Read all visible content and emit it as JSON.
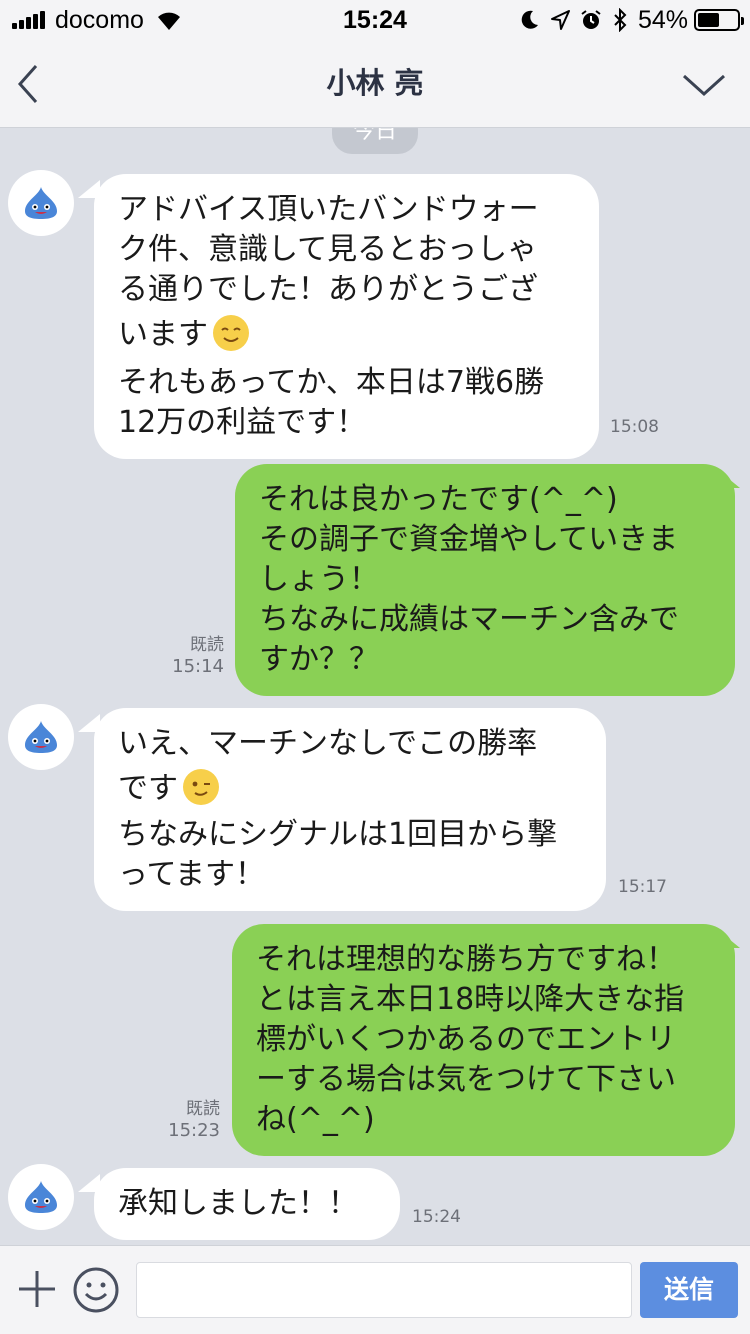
{
  "status_bar": {
    "carrier": "docomo",
    "time": "15:24",
    "battery_percent": "54%",
    "battery_level": 0.54,
    "icons": [
      "signal-icon",
      "wifi-icon",
      "moon-icon",
      "location-icon",
      "alarm-icon",
      "bluetooth-icon",
      "battery-icon"
    ]
  },
  "header": {
    "title": "小林 亮",
    "back_icon": "chevron-left-icon",
    "menu_icon": "chevron-down-icon"
  },
  "date_badge": "今日",
  "messages": [
    {
      "id": "m1",
      "direction": "in",
      "lines": [
        "アドバイス頂いたバンドウォー",
        "ク件、意識して見るとおっしゃ",
        "る通りでした！ありがとうござ",
        "います",
        "それもあってか、本日は7戦6勝",
        "12万の利益です！"
      ],
      "emoji_after_line": 3,
      "emoji": "smiling-face-emoji",
      "time": "15:08"
    },
    {
      "id": "m2",
      "direction": "out",
      "lines": [
        "それは良かったです(^_^)",
        "その調子で資金増やしていきま",
        "しょう！",
        "ちなみに成績はマーチン含みで",
        "すか？？"
      ],
      "read": "既読",
      "time": "15:14"
    },
    {
      "id": "m3",
      "direction": "in",
      "lines": [
        "いえ、マーチンなしでこの勝率",
        "です",
        "ちなみにシグナルは1回目から撃",
        "ってます！"
      ],
      "emoji_after_line": 1,
      "emoji": "winking-face-emoji",
      "time": "15:17"
    },
    {
      "id": "m4",
      "direction": "out",
      "lines": [
        "それは理想的な勝ち方ですね！",
        "とは言え本日18時以降大きな指",
        "標がいくつかあるのでエントリ",
        "ーする場合は気をつけて下さい",
        "ね(^_^)"
      ],
      "read": "既読",
      "time": "15:23"
    },
    {
      "id": "m5",
      "direction": "in",
      "lines": [
        "承知しました！！"
      ],
      "time": "15:24"
    }
  ],
  "input_bar": {
    "placeholder": "",
    "send_label": "送信",
    "plus_icon": "plus-icon",
    "sticker_icon": "smiley-icon"
  },
  "colors": {
    "chat_background": "#dcdfe6",
    "incoming_bubble": "#ffffff",
    "outgoing_bubble": "#8ad055",
    "send_button": "#5c8ee0"
  }
}
